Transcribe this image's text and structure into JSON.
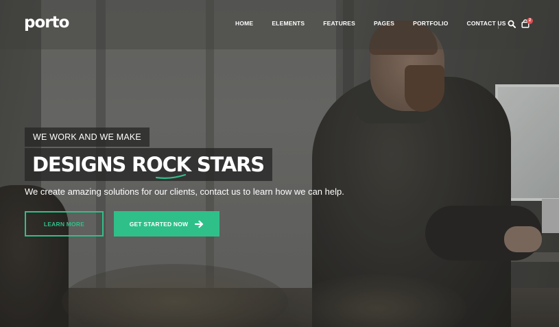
{
  "header": {
    "logo_text": "porto",
    "nav": [
      {
        "label": "HOME"
      },
      {
        "label": "ELEMENTS"
      },
      {
        "label": "FEATURES"
      },
      {
        "label": "PAGES"
      },
      {
        "label": "PORTFOLIO"
      },
      {
        "label": "CONTACT US"
      }
    ],
    "cart_count": "2",
    "icons": {
      "search": "search-icon",
      "cart": "cart-icon"
    }
  },
  "hero": {
    "tagline": "WE WORK AND WE MAKE",
    "headline": "DESIGNS ROCK STARS",
    "subtext": "We create amazing solutions for our clients, contact us to learn how we can help.",
    "btn_learn_more": "LEARN MORE",
    "btn_get_started": "GET STARTED NOW",
    "arrow_icon": "arrow-right-icon"
  },
  "colors": {
    "accent": "#2fc08a",
    "badge": "#e24c4c",
    "label_bg": "#262626"
  }
}
